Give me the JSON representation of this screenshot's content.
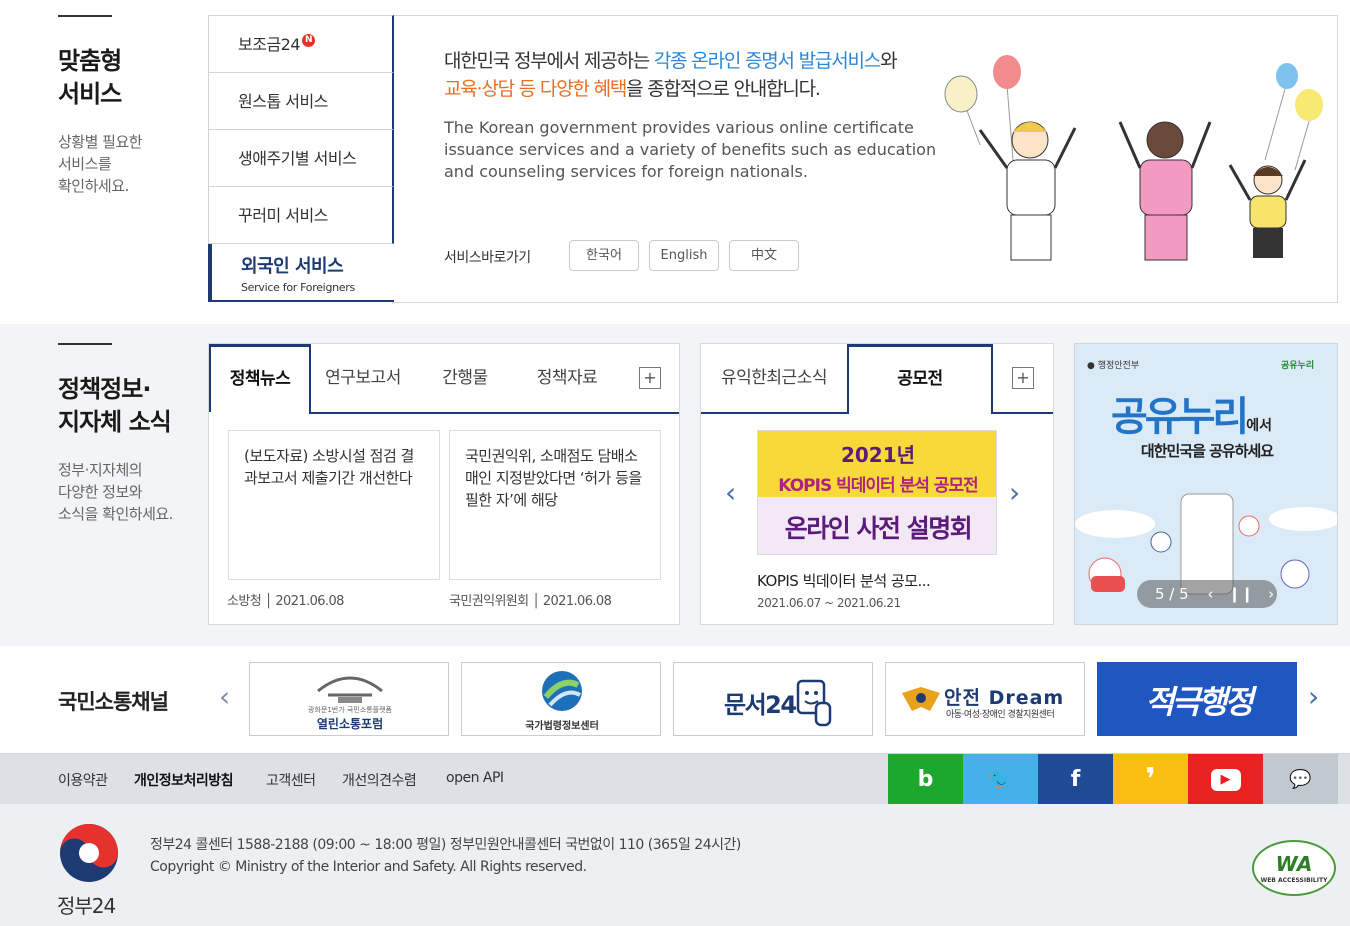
{
  "custom": {
    "title_line1": "맞춤형",
    "title_line2": "서비스",
    "desc_line1": "상황별 필요한",
    "desc_line2": "서비스를",
    "desc_line3": "확인하세요.",
    "tabs": [
      {
        "label": "보조금24",
        "badge": "N"
      },
      {
        "label": "원스톱 서비스"
      },
      {
        "label": "생애주기별 서비스"
      },
      {
        "label": "꾸러미 서비스"
      },
      {
        "label": "외국인 서비스",
        "sub": "Service for Foreigners"
      }
    ],
    "kor_p1": "대한민국 정부에서 제공하는 ",
    "kor_hl1": "각종 온라인 증명서 발급서비스",
    "kor_p2": "와",
    "kor_hl2a": "교육·상담 등 ",
    "kor_hl2b": "다양한 혜택",
    "kor_p3": "을 종합적으로 안내합니다.",
    "eng_text": "The Korean government provides various online certificate issuance services and a variety of benefits such as education and counseling services for foreign nationals.",
    "shortcut_label": "서비스바로가기",
    "lang_buttons": [
      "한국어",
      "English",
      "中文"
    ]
  },
  "policy": {
    "title_line1": "정책정보·",
    "title_line2": "지자체 소식",
    "desc_line1": "정부·지자체의",
    "desc_line2": "다양한 정보와",
    "desc_line3": "소식을 확인하세요.",
    "tabs": [
      "정책뉴스",
      "연구보고서",
      "간행물",
      "정책자료"
    ],
    "more": "+",
    "news": [
      {
        "title": "(보도자료) 소방시설 점검 결과보고서 제출기간 개선한다",
        "source": "소방청",
        "date": "2021.06.08"
      },
      {
        "title": "국민권익위, 소매점도 담배소매인 지정받았다면 ‘허가 등을 필한 자’에 해당",
        "source": "국민권익위원회",
        "date": "2021.06.08"
      }
    ],
    "right_tabs": [
      "유익한최근소식",
      "공모전"
    ],
    "contest": {
      "poster_year": "2021년",
      "poster_line1": "KOPIS 빅데이터 분석 공모전",
      "poster_line2": "온라인 사전 설명회",
      "title": "KOPIS 빅데이터 분석 공모...",
      "period": "2021.06.07 ~ 2021.06.21"
    },
    "banner": {
      "ministry": "행정안전부",
      "brand_small": "공유누리",
      "big": "공유누리",
      "suffix": "에서",
      "sub": "대한민국을 공유하세요",
      "counter": "5 / 5"
    }
  },
  "channel": {
    "title": "국민소통채널",
    "banners": [
      {
        "top": "광화문1번가 국민소통플랫폼",
        "label": "열린소통포럼"
      },
      {
        "label": "국가법령정보센터"
      },
      {
        "label": "문서24"
      },
      {
        "label": "안전 Dream",
        "sub": "아동·여성·장애인 경찰지원센터"
      },
      {
        "label": "적극행정"
      }
    ]
  },
  "footer_nav": {
    "links": [
      "이용약관",
      "개인정보처리방침",
      "고객센터",
      "개선의견수렴",
      "open API"
    ],
    "sns": [
      {
        "icon": "blog-icon",
        "glyph": "b",
        "color": "#1ca82d"
      },
      {
        "icon": "twitter-icon",
        "glyph": "🐦",
        "color": "#45b1e8"
      },
      {
        "icon": "facebook-icon",
        "glyph": "f",
        "color": "#1f4a96"
      },
      {
        "icon": "kakao-story-icon",
        "glyph": "❜",
        "color": "#f9be12"
      },
      {
        "icon": "youtube-icon",
        "glyph": "▶",
        "color": "#e82121"
      },
      {
        "icon": "chat-icon",
        "glyph": "💬",
        "color": "#c1c8d0"
      }
    ]
  },
  "footer": {
    "logo_text": "정부24",
    "line1": "정부24 콜센터 1588-2188 (09:00 ~ 18:00 평일) 정부민원안내콜센터 국번없이 110 (365일 24시간)",
    "line2": "Copyright © Ministry of the Interior and Safety. All Rights reserved.",
    "wa_label": "WA",
    "wa_sub": "WEB ACCESSIBILITY"
  }
}
